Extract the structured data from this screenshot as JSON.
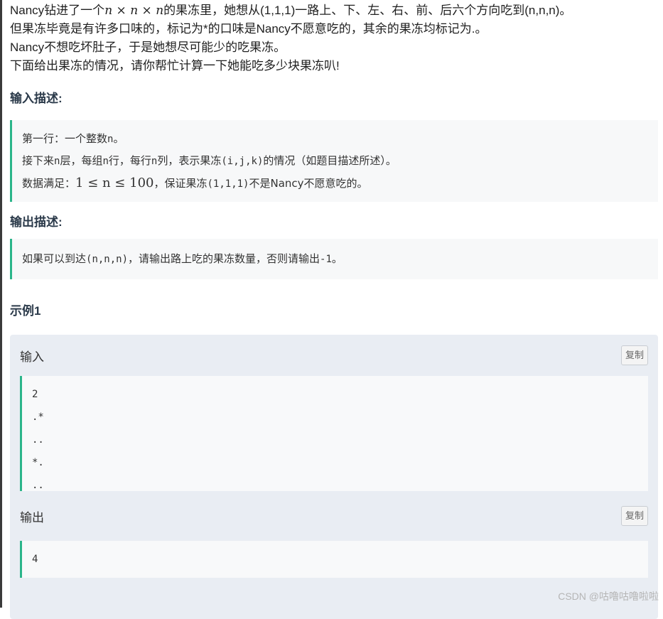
{
  "intro": {
    "line1_pre": "Nancy钻进了一个",
    "line1_math": "n × n × n",
    "line1_post": "的果冻里，她想从(1,1,1)一路上、下、左、右、前、后六个方向吃到(n,n,n)。",
    "line2": "但果冻毕竟是有许多口味的，标记为*的口味是Nancy不愿意吃的，其余的果冻均标记为.。",
    "line3": "Nancy不想吃坏肚子，于是她想尽可能少的吃果冻。",
    "line4": "下面给出果冻的情况，请你帮忙计算一下她能吃多少块果冻叭!"
  },
  "input_section": {
    "heading": "输入描述:",
    "line1_pre": "第一行：一个整数",
    "line1_var": "n",
    "line1_post": "。",
    "line2_pre": "接下来",
    "line2_a": "n",
    "line2_mid1": "层，每组",
    "line2_b": "n",
    "line2_mid2": "行，每行",
    "line2_c": "n",
    "line2_mid3": "列，表示果冻",
    "line2_coord": "(i,j,k)",
    "line2_post": "的情况（如题目描述所述）。",
    "line3_pre": "数据满足：",
    "line3_math": "1 ≤ n ≤ 100",
    "line3_mid": "，保证果冻",
    "line3_coord": "(1,1,1)",
    "line3_post": "不是Nancy不愿意吃的。"
  },
  "output_section": {
    "heading": "输出描述:",
    "line_pre": "如果可以到达",
    "line_coord": "(n,n,n)",
    "line_mid": "，请输出路上吃的果冻数量，否则请输出",
    "line_val": "-1",
    "line_post": "。"
  },
  "example": {
    "heading": "示例1",
    "input_label": "输入",
    "output_label": "输出",
    "copy_label": "复制",
    "input_lines": [
      "2",
      ".*",
      "..",
      "*.",
      ".."
    ],
    "output_lines": [
      "4"
    ]
  },
  "watermark": "CSDN @咕噜咕噜啦啦",
  "colors": {
    "accent": "#2bb58a",
    "example_bg": "#e9edf3",
    "quote_bg": "#f7f8f9"
  }
}
